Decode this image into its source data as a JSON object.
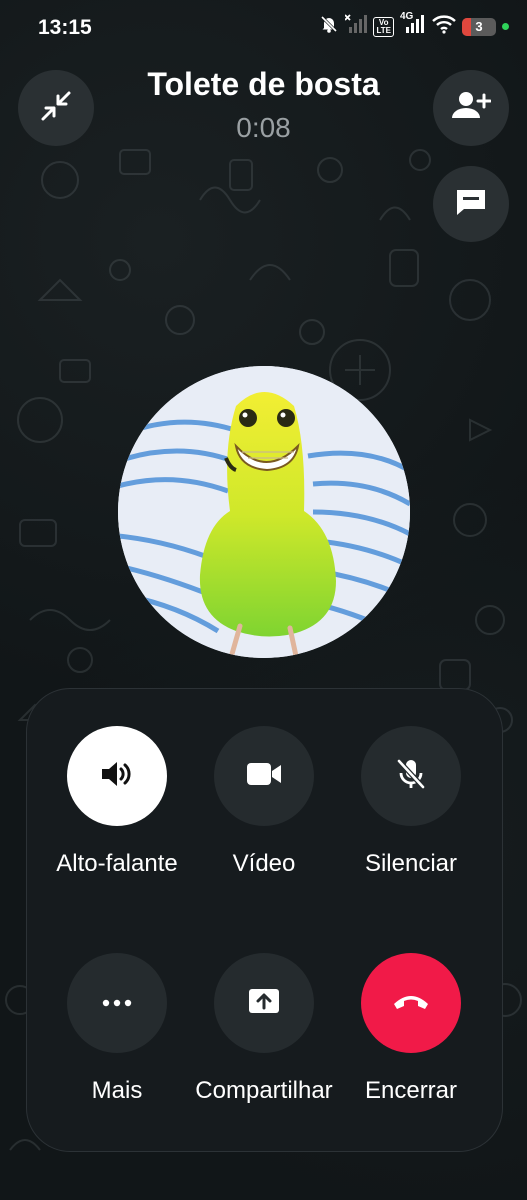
{
  "status_bar": {
    "time": "13:15",
    "battery_level": "3",
    "icons": [
      "mute-notifications-icon",
      "no-signal-icon",
      "volte-icon",
      "4g-signal-icon",
      "wifi-icon",
      "battery-icon",
      "active-dot-icon"
    ],
    "volte_top": "Vo",
    "volte_bottom": "LTE",
    "network": "4G"
  },
  "call": {
    "callee_name": "Tolete de bosta",
    "duration": "0:08"
  },
  "header_buttons": {
    "minimize_icon": "collapse-icon",
    "add_participant_icon": "add-person-icon",
    "chat_icon": "message-icon"
  },
  "controls": {
    "speaker": {
      "label": "Alto-falante",
      "icon": "speaker-icon",
      "active": true
    },
    "video": {
      "label": "Vídeo",
      "icon": "video-camera-icon"
    },
    "mute": {
      "label": "Silenciar",
      "icon": "mic-off-icon"
    },
    "more": {
      "label": "Mais",
      "icon": "more-dots-icon"
    },
    "share": {
      "label": "Compartilhar",
      "icon": "share-screen-icon"
    },
    "end": {
      "label": "Encerrar",
      "icon": "end-call-icon"
    }
  },
  "colors": {
    "end_call": "#f11a48",
    "button_bg": "#252b2e",
    "active_button_bg": "#ffffff",
    "status_dot": "#2fd35a"
  }
}
